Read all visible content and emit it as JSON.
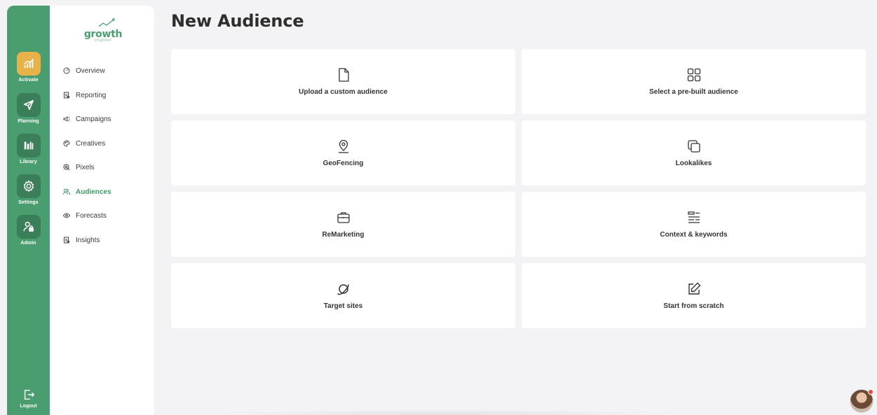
{
  "rail": {
    "items": [
      {
        "label": "Activate",
        "icon": "activate-chart-icon",
        "active": true
      },
      {
        "label": "Planning",
        "icon": "paper-plane-icon",
        "active": false
      },
      {
        "label": "Library",
        "icon": "library-books-icon",
        "active": false
      },
      {
        "label": "Settings",
        "icon": "gear-icon",
        "active": false
      },
      {
        "label": "Admin",
        "icon": "admin-user-lock-icon",
        "active": false
      }
    ],
    "logout_label": "Logout"
  },
  "logo": {
    "word": "growth",
    "sub": "channel"
  },
  "subnav": {
    "items": [
      {
        "label": "Overview",
        "icon": "gauge-icon"
      },
      {
        "label": "Reporting",
        "icon": "report-icon"
      },
      {
        "label": "Campaigns",
        "icon": "megaphone-icon"
      },
      {
        "label": "Creatives",
        "icon": "palette-icon"
      },
      {
        "label": "Pixels",
        "icon": "pixel-target-icon"
      },
      {
        "label": "Audiences",
        "icon": "users-icon",
        "active": true
      },
      {
        "label": "Forecasts",
        "icon": "eye-icon"
      },
      {
        "label": "Insights",
        "icon": "insights-icon"
      }
    ]
  },
  "page": {
    "title": "New Audience"
  },
  "cards": [
    {
      "label": "Upload a custom audience",
      "icon": "file-icon"
    },
    {
      "label": "Select a pre-built audience",
      "icon": "grid-icon"
    },
    {
      "label": "GeoFencing",
      "icon": "map-pin-icon"
    },
    {
      "label": "Lookalikes",
      "icon": "copy-icon"
    },
    {
      "label": "ReMarketing",
      "icon": "briefcase-icon"
    },
    {
      "label": "Context & keywords",
      "icon": "text-lines-icon"
    },
    {
      "label": "Target sites",
      "icon": "planet-icon"
    },
    {
      "label": "Start from scratch",
      "icon": "edit-icon"
    }
  ],
  "colors": {
    "brand_green": "#4a9d6f",
    "active_orange": "#e8b24a",
    "active_text": "#3f9a67"
  }
}
